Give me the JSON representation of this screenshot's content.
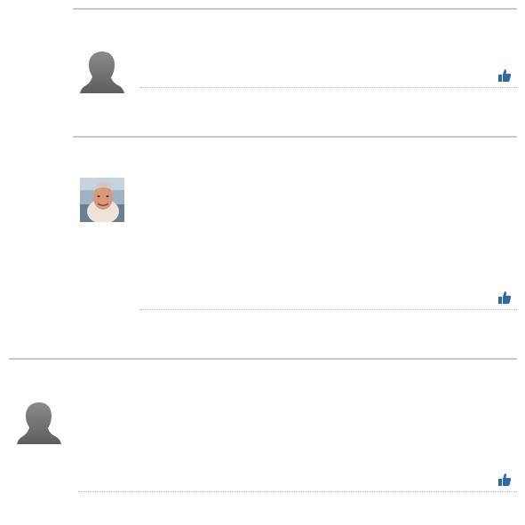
{
  "comments": [
    {
      "avatar": "silhouette-avatar",
      "like_icon": "thumbs-up-icon"
    },
    {
      "avatar": "photo-avatar",
      "like_icon": "thumbs-up-icon"
    },
    {
      "avatar": "silhouette-avatar",
      "like_icon": "thumbs-up-icon"
    }
  ],
  "colors": {
    "separator": "#c8c8c8",
    "dotted_line": "#b8b8b8",
    "like_icon": "#2e6aa8",
    "silhouette": "#7a7a7a"
  }
}
